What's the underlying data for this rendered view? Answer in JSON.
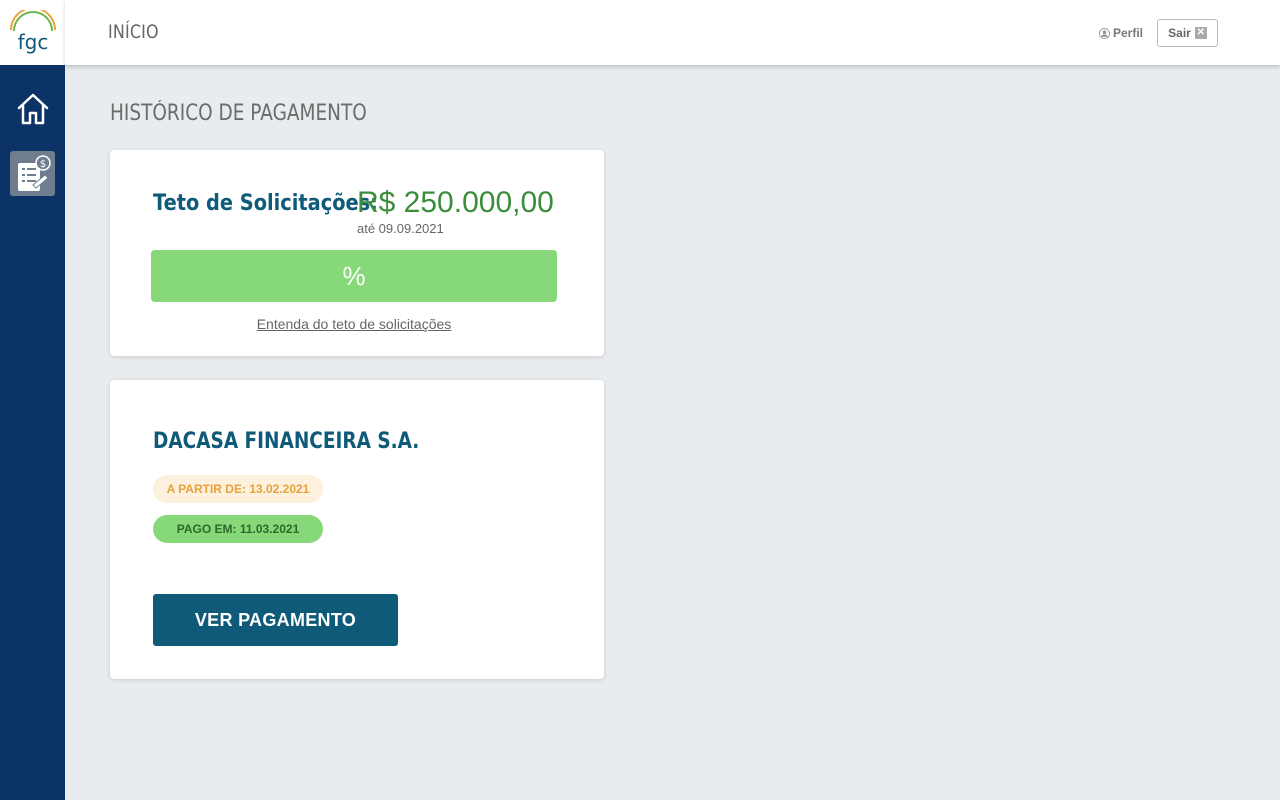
{
  "app": {
    "logo_text": "fgc",
    "colors": {
      "sidebar": "#0b3366",
      "accent": "#0e5a78",
      "success": "#86d878",
      "warning": "#e6a23c"
    }
  },
  "sidebar": {
    "items": [
      {
        "icon": "home-icon",
        "active": false
      },
      {
        "icon": "payment-document-icon",
        "active": true
      }
    ]
  },
  "header": {
    "title": "INÍCIO",
    "perfil_label": "Perfil",
    "sair_label": "Sair",
    "sair_icon_glyph": "✕"
  },
  "page": {
    "title": "HISTÓRICO DE PAGAMENTO"
  },
  "teto": {
    "label": "Teto de Solicitações:",
    "value": "R$ 250.000,00",
    "date": "até 09.09.2021",
    "progress_text": "%",
    "progress_fraction": 1.0,
    "link_text": "Entenda do teto de solicitações"
  },
  "payment": {
    "company": "DACASA FINANCEIRA S.A.",
    "partir_badge": "A PARTIR DE: 13.02.2021",
    "pago_badge": "PAGO EM: 11.03.2021",
    "button_label": "VER PAGAMENTO"
  }
}
